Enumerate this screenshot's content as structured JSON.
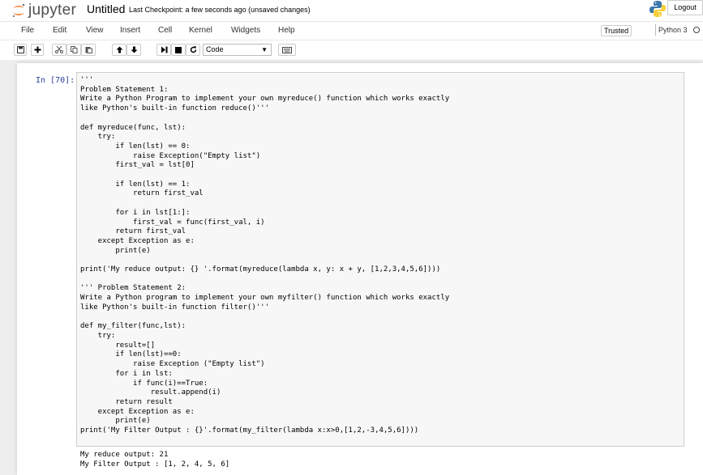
{
  "header": {
    "logo_text": "jupyter",
    "notebook_title": "Untitled",
    "checkpoint": "Last Checkpoint: a few seconds ago  (unsaved changes)",
    "logout_label": "Logout"
  },
  "menubar": {
    "items": [
      "File",
      "Edit",
      "View",
      "Insert",
      "Cell",
      "Kernel",
      "Widgets",
      "Help"
    ],
    "trusted_label": "Trusted",
    "kernel_name": "Python 3"
  },
  "toolbar": {
    "cell_type": "Code",
    "icons": [
      "save-icon",
      "plus-icon",
      "scissors-icon",
      "copy-icon",
      "paste-icon",
      "arrow-up-icon",
      "arrow-down-icon",
      "step-forward-icon",
      "stop-icon",
      "refresh-icon",
      "keyboard-icon"
    ]
  },
  "cell": {
    "prompt": "In [70]:",
    "code_lines": [
      "'''",
      "Problem Statement 1:",
      "Write a Python Program to implement your own myreduce() function which works exactly",
      "like Python's built-in function reduce()'''",
      "",
      "def myreduce(func, lst):",
      "    try:",
      "        if len(lst) == 0:",
      "            raise Exception(\"Empty list\")",
      "        first_val = lst[0]",
      "",
      "        if len(lst) == 1:",
      "            return first_val",
      "",
      "        for i in lst[1:]:",
      "            first_val = func(first_val, i)",
      "        return first_val",
      "    except Exception as e:",
      "        print(e)",
      "",
      "print('My reduce output: {} '.format(myreduce(lambda x, y: x + y, [1,2,3,4,5,6])))",
      "",
      "''' Problem Statement 2:",
      "Write a Python program to implement your own myfilter() function which works exactly",
      "like Python's built-in function filter()'''",
      "",
      "def my_filter(func,lst):",
      "    try:",
      "        result=[]",
      "        if len(lst)==0:",
      "            raise Exception (\"Empty list\")",
      "        for i in lst:",
      "            if func(i)==True:",
      "                result.append(i)",
      "        return result",
      "    except Exception as e:",
      "        print(e)",
      "print('My Filter Output : {}'.format(my_filter(lambda x:x>0,[1,2,-3,4,5,6])))"
    ],
    "output_lines": [
      "My reduce output: 21",
      "My Filter Output : [1, 2, 4, 5, 6]"
    ]
  },
  "colors": {
    "logo_orange": "#f37726",
    "prompt_blue": "#303f9f",
    "background": "#eeeeee"
  }
}
